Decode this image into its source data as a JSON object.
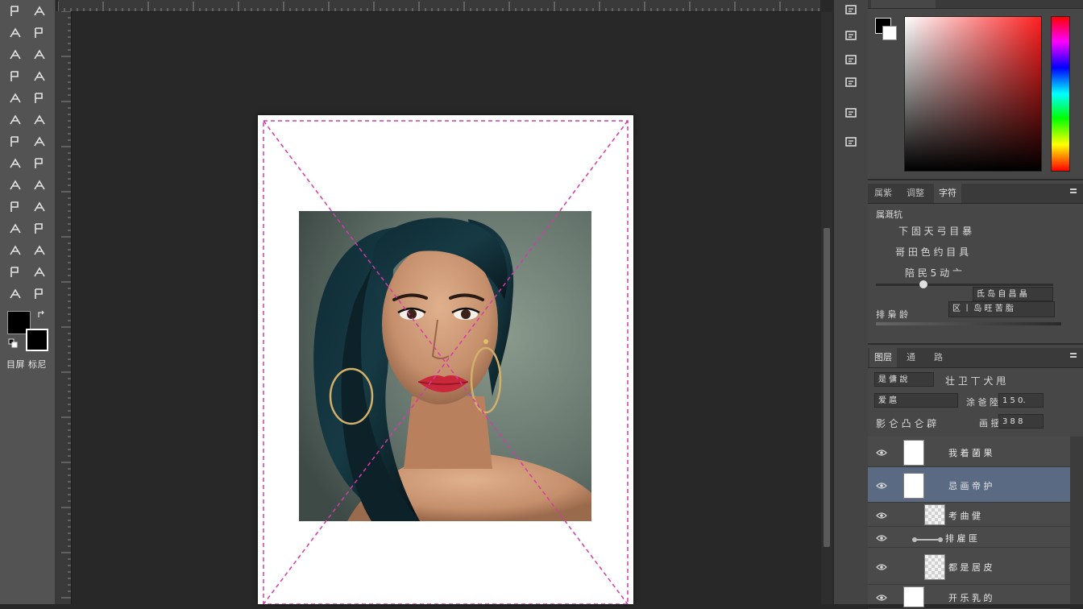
{
  "colors": {
    "foreground": "#000000",
    "background": "#ffffff",
    "accent_guides": "#d63aa8",
    "selected_layer": "#5a6a82"
  },
  "toolbar": {
    "tools": [
      "move-tool-icon",
      "artboard-tool-icon",
      "lasso-tool-icon",
      "rotate-view-icon",
      "marquee-tool-icon",
      "polygon-lasso-icon",
      "quick-select-icon",
      "magic-wand-icon",
      "crop-tool-icon",
      "eyedropper-icon",
      "spot-heal-icon",
      "brush-tool-icon",
      "clone-stamp-icon",
      "history-brush-icon",
      "eraser-tool-icon",
      "gradient-tool-icon",
      "blur-tool-icon",
      "dodge-tool-icon",
      "pen-tool-icon",
      "path-select-icon",
      "type-tool-icon",
      "shape-tool-icon",
      "hand-tool-icon",
      "zoom-tool-icon",
      "edit-toolbar-icon",
      "quick-mask-icon",
      "screen-mode-icon",
      "frame-tool-icon"
    ],
    "bottom_label": "目屏 标尼"
  },
  "iconstrip": {
    "buttons": [
      "history-icon",
      "swatches-icon",
      "brush-settings-icon",
      "libraries-icon",
      "adjust-icon",
      "image-icon"
    ]
  },
  "color_panel": {
    "tabs": [
      "",
      ""
    ]
  },
  "properties_panel": {
    "tabs": [
      "属紫",
      "调整",
      "字符"
    ],
    "section_title": "属溉牨",
    "row1": "下 固 天 弓 目 暴",
    "row2": "哥 田 色 约 目 具",
    "row3": "陪 民 5 动 亠",
    "dropdown_value": "氐 岛 自 昌 瞐",
    "dropdown2_value": "区 丨 岛 旺 苦 脂",
    "label2": "排 梟 龄"
  },
  "layers_panel": {
    "tabs": [
      "图层",
      "通",
      "路"
    ],
    "row1_select": "是 傭 說",
    "row1_icons": "壮 卫 丅 犬 甩",
    "row2_select": "爱 扈",
    "row2_label": "涂 爸 陸",
    "row2_value": "1 5 0.",
    "row3_icons": "影 仑 凸 仑 辟",
    "row3_label": "画 揺",
    "row3_value": "3 8 8",
    "layers": [
      {
        "name": "我 着 菌 果",
        "selected": false,
        "thumb": "white"
      },
      {
        "name": "忌 画 帝 护",
        "selected": true,
        "thumb": "white"
      },
      {
        "name": "考 曲 健",
        "selected": false,
        "thumb": "checker"
      },
      {
        "name": "排 雇 匪",
        "selected": false,
        "thumb": "none"
      },
      {
        "name": "都 是 居 皮",
        "selected": false,
        "thumb": "checker"
      },
      {
        "name": "开 乐 乳 的",
        "selected": false,
        "thumb": "white"
      }
    ]
  }
}
